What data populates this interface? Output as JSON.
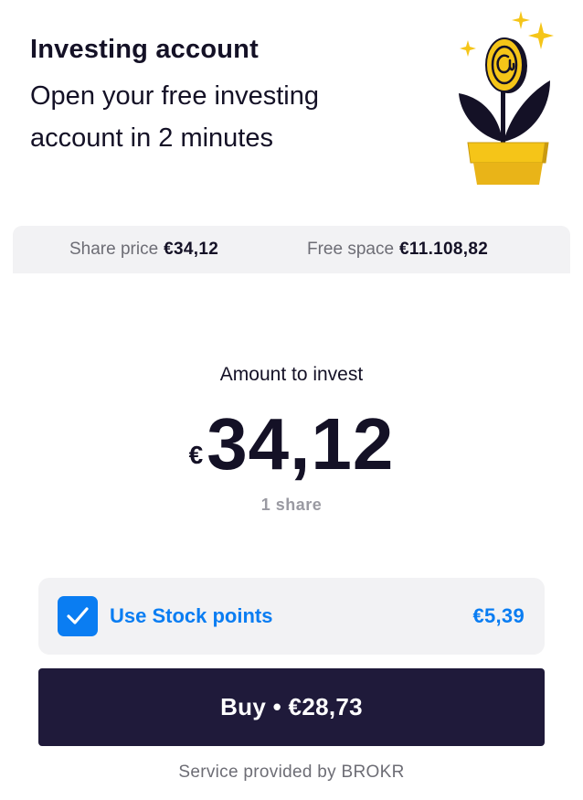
{
  "header": {
    "title": "Investing account",
    "subtitle": "Open your free investing account in 2 minutes",
    "illustration_icon": "coin-plant-icon"
  },
  "info": {
    "share_price_label": "Share price",
    "share_price_value": "€34,12",
    "free_space_label": "Free space",
    "free_space_value": "€11.108,82"
  },
  "amount": {
    "label": "Amount to invest",
    "currency": "€",
    "value": "34,12",
    "shares": "1 share"
  },
  "stock_points": {
    "checked": true,
    "label": "Use Stock points",
    "value": "€5,39"
  },
  "buy_button": {
    "label": "Buy • €28,73"
  },
  "footer": {
    "text": "Service provided by BROKR"
  },
  "colors": {
    "primary_dark": "#1f1a3a",
    "accent_blue": "#0a7df2",
    "coin_yellow": "#f5c518",
    "pot_yellow": "#e9b418",
    "panel_gray": "#f2f2f4"
  }
}
